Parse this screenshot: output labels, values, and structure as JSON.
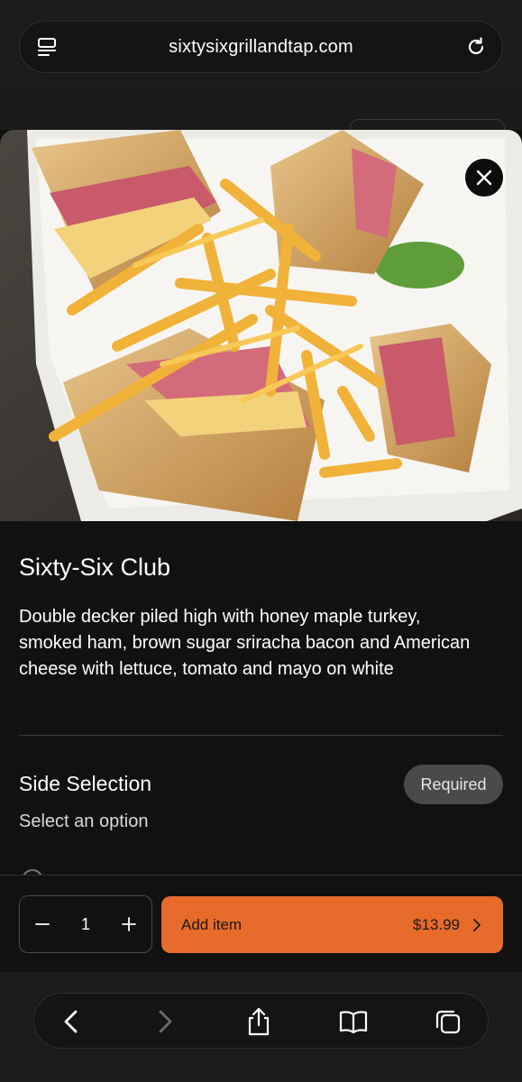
{
  "browser": {
    "url": "sixtysixgrillandtap.com",
    "menu_icon": "page-menu-icon",
    "reload_icon": "reload-icon"
  },
  "item": {
    "title": "Sixty-Six Club",
    "description": "Double decker piled high with honey maple turkey, smoked ham, brown sugar sriracha bacon and American cheese with lettuce, tomato and mayo on white",
    "image_alt": "club sandwich with fries"
  },
  "options": {
    "title": "Side Selection",
    "subtitle": "Select an option",
    "badge": "Required"
  },
  "order": {
    "quantity": "1",
    "add_label": "Add item",
    "price": "$13.99"
  },
  "colors": {
    "accent": "#e76b2b",
    "background": "#111111"
  },
  "toolbar": {
    "icons": [
      "back-icon",
      "forward-icon",
      "share-icon",
      "bookmarks-icon",
      "tabs-icon"
    ]
  }
}
